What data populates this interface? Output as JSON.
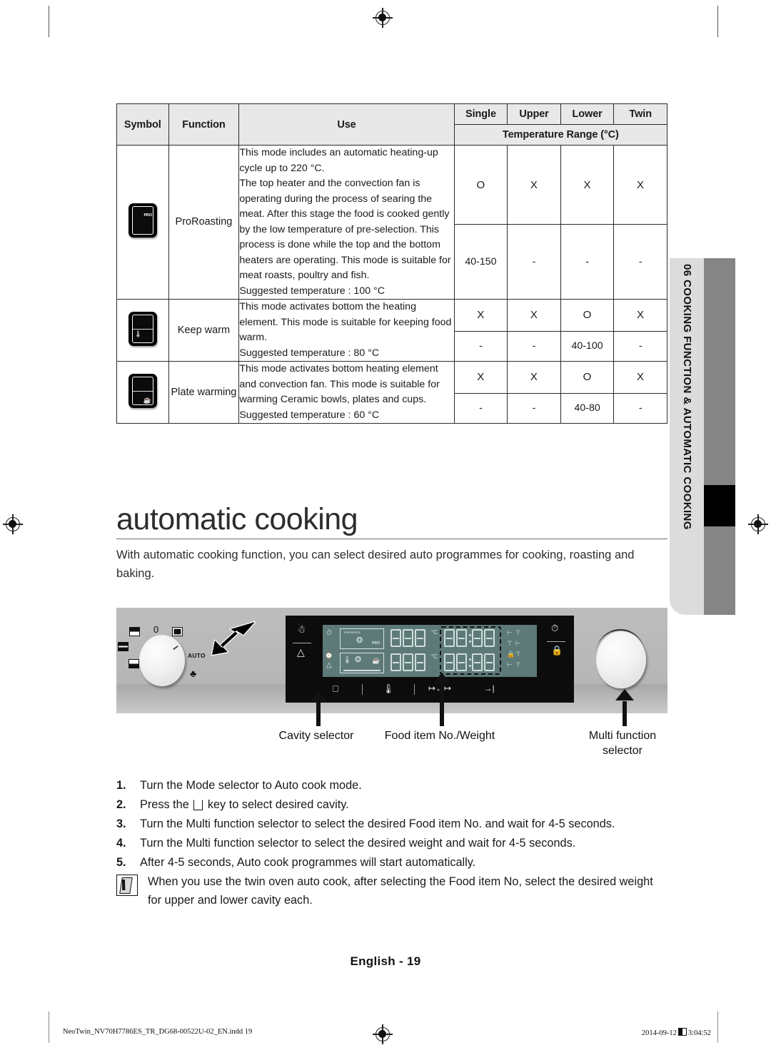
{
  "side_tab": {
    "label": "06  COOKING FUNCTION & AUTOMATIC COOKING"
  },
  "table": {
    "headers": {
      "symbol": "Symbol",
      "function": "Function",
      "use": "Use",
      "single": "Single",
      "upper": "Upper",
      "lower": "Lower",
      "twin": "Twin",
      "temp_range": "Temperature Range (°C)"
    },
    "rows": [
      {
        "symbol_icon": "oven-proroasting-icon",
        "function": "ProRoasting",
        "use": "This mode includes an automatic heating-up cycle up to 220 °C.\nThe top heater and the convection fan is operating during the process of searing the meat. After this stage the food is cooked gently by the low temperature of pre-selection. This process is done while the top and the bottom heaters are operating. This mode is suitable for meat roasts, poultry and fish.\nSuggested temperature : 100 °C",
        "availability": [
          "O",
          "X",
          "X",
          "X"
        ],
        "ranges": [
          "40-150",
          "-",
          "-",
          "-"
        ]
      },
      {
        "symbol_icon": "oven-keepwarm-icon",
        "function": "Keep warm",
        "use": "This mode activates bottom the heating element. This mode is suitable for keeping food warm.\nSuggested temperature : 80 °C",
        "availability": [
          "X",
          "X",
          "O",
          "X"
        ],
        "ranges": [
          "-",
          "-",
          "40-100",
          "-"
        ]
      },
      {
        "symbol_icon": "oven-platewarming-icon",
        "function": "Plate warming",
        "use": "This mode activates bottom heating element and convection fan. This mode is suitable for warming Ceramic bowls, plates and cups.\nSuggested temperature : 60 °C",
        "availability": [
          "X",
          "X",
          "O",
          "X"
        ],
        "ranges": [
          "-",
          "-",
          "40-80",
          "-"
        ]
      }
    ]
  },
  "chapter": {
    "title": "automatic cooking",
    "intro": "With automatic cooking function, you can select desired auto programmes for cooking, roasting and baking."
  },
  "panel": {
    "mode_knob_label": "AUTO",
    "mode_knob_zero": "0",
    "callouts": [
      {
        "label": "Cavity selector"
      },
      {
        "label": "Food item No./Weight"
      },
      {
        "label": "Multi function\nselector"
      }
    ],
    "lcd": {
      "upper_temp": "888",
      "lower_temp": "888",
      "upper_time": "88:88",
      "lower_time": "88:88",
      "unit": "°C"
    }
  },
  "steps": [
    {
      "num": "1.",
      "text_before": "Turn the Mode selector to Auto cook mode.",
      "text_after": ""
    },
    {
      "num": "2.",
      "text_before": "Press the ",
      "text_after": " key to select desired cavity.",
      "has_key_icon": true
    },
    {
      "num": "3.",
      "text_before": "Turn the Multi function selector to select the desired Food item No. and wait for 4-5 seconds.",
      "text_after": ""
    },
    {
      "num": "4.",
      "text_before": "Turn the Multi function selector to select the desired weight and wait for 4-5 seconds.",
      "text_after": ""
    },
    {
      "num": "5.",
      "text_before": "After 4-5 seconds, Auto cook programmes will start automatically.",
      "text_after": ""
    }
  ],
  "note": {
    "text": "When you use the twin oven auto cook, after selecting the Food item No, select the desired weight for upper and lower cavity each."
  },
  "footer": {
    "page_label": "English - 19",
    "file_name": "NeoTwin_NV70H7786ES_TR_DG68-00522U-02_EN.indd   19",
    "date": "2014-09-12",
    "time": "3:04:52"
  }
}
